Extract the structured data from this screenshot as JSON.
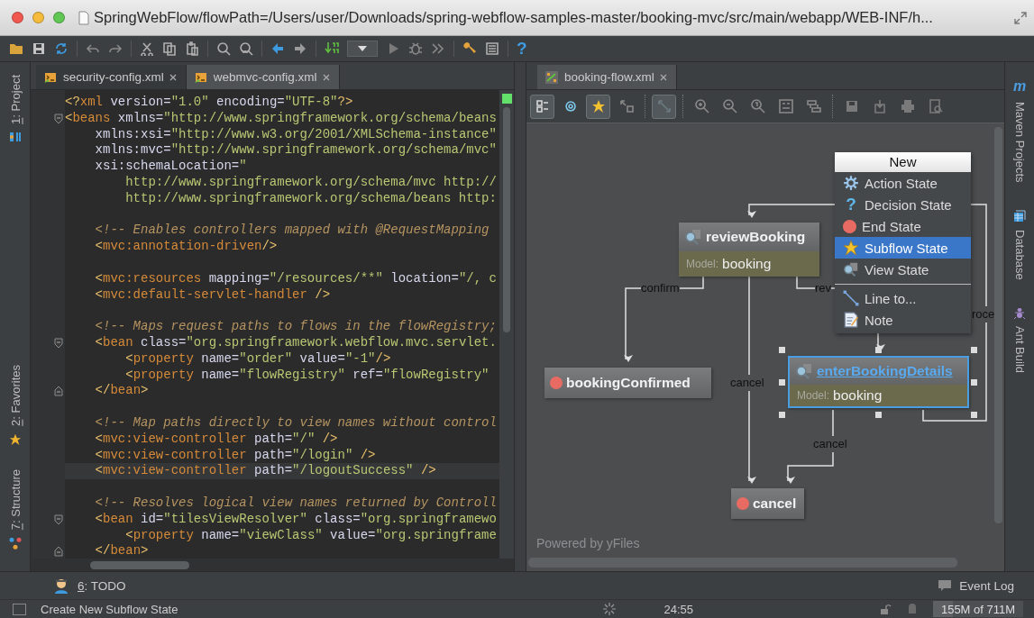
{
  "window": {
    "title": "SpringWebFlow/flowPath=/Users/user/Downloads/spring-webflow-samples-master/booking-mvc/src/main/webapp/WEB-INF/h..."
  },
  "main_toolbar": {
    "help_glyph": "?"
  },
  "left_tool_strip": [
    {
      "key": "1",
      "label": ": Project",
      "selected": false
    },
    {
      "key": "2",
      "label": ": Favorites",
      "selected": false
    },
    {
      "key": "7",
      "label": ": Structure",
      "selected": false
    }
  ],
  "right_tool_strip": [
    {
      "label": "Maven Projects",
      "icon_glyph": "m"
    },
    {
      "label": "Database"
    },
    {
      "label": "Ant Build"
    }
  ],
  "editor": {
    "tabs": [
      {
        "label": "security-config.xml",
        "selected": false
      },
      {
        "label": "webmvc-config.xml",
        "selected": true
      }
    ],
    "lines": [
      {
        "kind": "code",
        "current": false,
        "tokens": [
          {
            "kind": "punct",
            "text": "<?"
          },
          {
            "kind": "tag",
            "text": "xml"
          },
          {
            "kind": "attr",
            "text": " version="
          },
          {
            "kind": "str",
            "text": "\"1.0\""
          },
          {
            "kind": "attr",
            "text": " encoding="
          },
          {
            "kind": "str",
            "text": "\"UTF-8\""
          },
          {
            "kind": "punct",
            "text": "?>"
          }
        ]
      },
      {
        "kind": "fold_start",
        "current": false,
        "tokens": [
          {
            "kind": "punct",
            "text": "<"
          },
          {
            "kind": "tag",
            "text": "beans"
          },
          {
            "kind": "attr",
            "text": " xmlns="
          },
          {
            "kind": "str",
            "text": "\"http://www.springframework.org/schema/beans"
          }
        ]
      },
      {
        "kind": "code",
        "current": false,
        "tokens": [
          {
            "kind": "attr",
            "text": "    xmlns:xsi="
          },
          {
            "kind": "str",
            "text": "\"http://www.w3.org/2001/XMLSchema-instance\""
          }
        ]
      },
      {
        "kind": "code",
        "current": false,
        "tokens": [
          {
            "kind": "attr",
            "text": "    xmlns:mvc="
          },
          {
            "kind": "str",
            "text": "\"http://www.springframework.org/schema/mvc\""
          }
        ]
      },
      {
        "kind": "code",
        "current": false,
        "tokens": [
          {
            "kind": "attr",
            "text": "    xsi:schemaLocation="
          },
          {
            "kind": "str",
            "text": "\""
          }
        ]
      },
      {
        "kind": "code",
        "current": false,
        "tokens": [
          {
            "kind": "str",
            "text": "        http://www.springframework.org/schema/mvc http://"
          }
        ]
      },
      {
        "kind": "code",
        "current": false,
        "tokens": [
          {
            "kind": "str",
            "text": "        http://www.springframework.org/schema/beans http:"
          }
        ]
      },
      {
        "kind": "blank"
      },
      {
        "kind": "code",
        "current": false,
        "tokens": [
          {
            "kind": "comment",
            "text": "    <!-- Enables controllers mapped with @RequestMapping"
          }
        ]
      },
      {
        "kind": "code",
        "current": false,
        "tokens": [
          {
            "kind": "punct",
            "text": "    <"
          },
          {
            "kind": "tag",
            "text": "mvc:annotation-driven"
          },
          {
            "kind": "punct",
            "text": "/>"
          }
        ]
      },
      {
        "kind": "blank"
      },
      {
        "kind": "code",
        "current": false,
        "tokens": [
          {
            "kind": "punct",
            "text": "    <"
          },
          {
            "kind": "tag",
            "text": "mvc:resources"
          },
          {
            "kind": "attr",
            "text": " mapping="
          },
          {
            "kind": "str",
            "text": "\"/resources/**\""
          },
          {
            "kind": "attr",
            "text": " location="
          },
          {
            "kind": "str",
            "text": "\"/, c"
          }
        ]
      },
      {
        "kind": "code",
        "current": false,
        "tokens": [
          {
            "kind": "punct",
            "text": "    <"
          },
          {
            "kind": "tag",
            "text": "mvc:default-servlet-handler"
          },
          {
            "kind": "punct",
            "text": " />"
          }
        ]
      },
      {
        "kind": "blank"
      },
      {
        "kind": "code",
        "current": false,
        "tokens": [
          {
            "kind": "comment",
            "text": "    <!-- Maps request paths to flows in the flowRegistry;"
          }
        ]
      },
      {
        "kind": "fold_start",
        "current": false,
        "tokens": [
          {
            "kind": "punct",
            "text": "    <"
          },
          {
            "kind": "tag",
            "text": "bean"
          },
          {
            "kind": "attr",
            "text": " class="
          },
          {
            "kind": "str",
            "text": "\"org.springframework.webflow.mvc.servlet."
          }
        ]
      },
      {
        "kind": "code",
        "current": false,
        "tokens": [
          {
            "kind": "punct",
            "text": "        <"
          },
          {
            "kind": "tag",
            "text": "property"
          },
          {
            "kind": "attr",
            "text": " name="
          },
          {
            "kind": "str",
            "text": "\"order\""
          },
          {
            "kind": "attr",
            "text": " value="
          },
          {
            "kind": "str",
            "text": "\"-1\""
          },
          {
            "kind": "punct",
            "text": "/>"
          }
        ]
      },
      {
        "kind": "code",
        "current": false,
        "tokens": [
          {
            "kind": "punct",
            "text": "        <"
          },
          {
            "kind": "tag",
            "text": "property"
          },
          {
            "kind": "attr",
            "text": " name="
          },
          {
            "kind": "str",
            "text": "\"flowRegistry\""
          },
          {
            "kind": "attr",
            "text": " ref="
          },
          {
            "kind": "str",
            "text": "\"flowRegistry\""
          }
        ]
      },
      {
        "kind": "fold_end",
        "current": false,
        "tokens": [
          {
            "kind": "punct",
            "text": "    </"
          },
          {
            "kind": "tag",
            "text": "bean"
          },
          {
            "kind": "punct",
            "text": ">"
          }
        ]
      },
      {
        "kind": "blank"
      },
      {
        "kind": "code",
        "current": false,
        "tokens": [
          {
            "kind": "comment",
            "text": "    <!-- Map paths directly to view names without control"
          }
        ]
      },
      {
        "kind": "code",
        "current": false,
        "tokens": [
          {
            "kind": "punct",
            "text": "    <"
          },
          {
            "kind": "tag",
            "text": "mvc:view-controller"
          },
          {
            "kind": "attr",
            "text": " path="
          },
          {
            "kind": "str",
            "text": "\"/\""
          },
          {
            "kind": "punct",
            "text": " />"
          }
        ]
      },
      {
        "kind": "code",
        "current": false,
        "tokens": [
          {
            "kind": "punct",
            "text": "    <"
          },
          {
            "kind": "tag",
            "text": "mvc:view-controller"
          },
          {
            "kind": "attr",
            "text": " path="
          },
          {
            "kind": "str",
            "text": "\"/login\""
          },
          {
            "kind": "punct",
            "text": " />"
          }
        ]
      },
      {
        "kind": "code",
        "current": true,
        "tokens": [
          {
            "kind": "punct",
            "text": "    <"
          },
          {
            "kind": "tag",
            "text": "mvc:view-controller"
          },
          {
            "kind": "attr",
            "text": " path="
          },
          {
            "kind": "str",
            "text": "\"/logoutSuccess\""
          },
          {
            "kind": "punct",
            "text": " />"
          }
        ]
      },
      {
        "kind": "blank"
      },
      {
        "kind": "code",
        "current": false,
        "tokens": [
          {
            "kind": "comment",
            "text": "    <!-- Resolves logical view names returned by Controll"
          }
        ]
      },
      {
        "kind": "fold_start",
        "current": false,
        "tokens": [
          {
            "kind": "punct",
            "text": "    <"
          },
          {
            "kind": "tag",
            "text": "bean"
          },
          {
            "kind": "attr",
            "text": " id="
          },
          {
            "kind": "str",
            "text": "\"tilesViewResolver\""
          },
          {
            "kind": "attr",
            "text": " class="
          },
          {
            "kind": "str",
            "text": "\"org.springframewo"
          }
        ]
      },
      {
        "kind": "code",
        "current": false,
        "tokens": [
          {
            "kind": "punct",
            "text": "        <"
          },
          {
            "kind": "tag",
            "text": "property"
          },
          {
            "kind": "attr",
            "text": " name="
          },
          {
            "kind": "str",
            "text": "\"viewClass\""
          },
          {
            "kind": "attr",
            "text": " value="
          },
          {
            "kind": "str",
            "text": "\"org.springframe"
          }
        ]
      },
      {
        "kind": "fold_end",
        "current": false,
        "tokens": [
          {
            "kind": "punct",
            "text": "    </"
          },
          {
            "kind": "tag",
            "text": "bean"
          },
          {
            "kind": "punct",
            "text": ">"
          }
        ]
      }
    ]
  },
  "diagram": {
    "tabs": [
      {
        "label": "booking-flow.xml",
        "selected": true
      }
    ],
    "toolbar": [
      {
        "selected": true
      },
      {
        "selected": false
      },
      {
        "selected": true
      },
      {
        "selected": false
      },
      {
        "selected": true
      },
      {
        "selected": false
      },
      {
        "selected": false
      },
      {
        "selected": false
      },
      {
        "selected": false
      },
      {
        "selected": false
      },
      {
        "selected": false
      },
      {
        "selected": false
      },
      {
        "selected": false
      },
      {
        "selected": false
      }
    ],
    "nodes": [
      {
        "name": "reviewBooking",
        "kind": "view",
        "model_label": "Model:",
        "model": "booking",
        "selected": false
      },
      {
        "name": "bookingConfirmed",
        "kind": "end",
        "selected": false
      },
      {
        "name": "enterBookingDetails",
        "kind": "view",
        "model_label": "Model:",
        "model": "booking",
        "selected": true
      },
      {
        "name": "cancel",
        "kind": "end",
        "selected": false
      }
    ],
    "edge_labels": [
      "confirm",
      "cancel",
      "rev",
      "cancel",
      "roce"
    ],
    "footer": "Powered by yFiles",
    "context_menu": {
      "title": "New",
      "items": [
        {
          "label": "Action State",
          "kind": "action",
          "selected": false,
          "separator_before": false
        },
        {
          "label": "Decision State",
          "kind": "decision",
          "icon_glyph": "?",
          "selected": false,
          "separator_before": false
        },
        {
          "label": "End State",
          "kind": "end",
          "selected": false,
          "separator_before": false
        },
        {
          "label": "Subflow State",
          "kind": "subflow",
          "selected": true,
          "separator_before": false
        },
        {
          "label": "View State",
          "kind": "view",
          "selected": false,
          "separator_before": false
        },
        {
          "label": "Line to...",
          "kind": "line",
          "selected": false,
          "separator_before": true
        },
        {
          "label": "Note",
          "kind": "note",
          "selected": false,
          "separator_before": false
        }
      ]
    }
  },
  "bottom_tool_bar": {
    "todo": {
      "key": "6",
      "label": ": TODO"
    },
    "event_log": "Event Log"
  },
  "status_bar": {
    "message": "Create New Subflow State",
    "position": "24:55",
    "memory": {
      "text": "155M of 711M",
      "level": 0.22
    }
  }
}
